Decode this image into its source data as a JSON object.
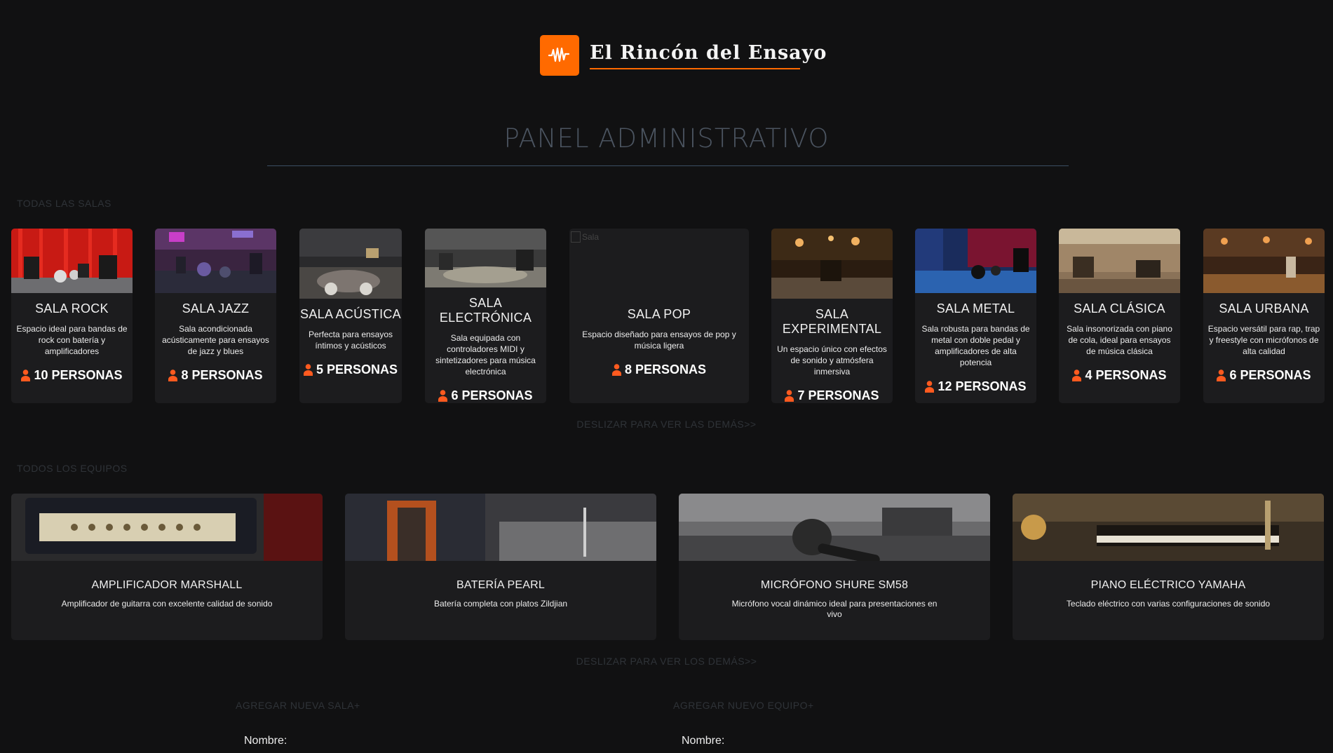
{
  "brand": {
    "name": "El Rincón del Ensayo",
    "accent": "#ff6a00",
    "logo_icon": "soundwave-icon"
  },
  "page": {
    "title": "PANEL ADMINISTRATIVO"
  },
  "rooms_section": {
    "label": "TODAS LAS SALAS",
    "swipe_hint": "DESLIZAR PARA VER LAS DEMÁS>>",
    "items": [
      {
        "name": "SALA ROCK",
        "description": "Espacio ideal para bandas de rock con batería y amplificadores",
        "capacity": "10 PERSONAS"
      },
      {
        "name": "SALA JAZZ",
        "description": "Sala acondicionada acústicamente para ensayos de jazz y blues",
        "capacity": "8 PERSONAS"
      },
      {
        "name": "SALA ACÚSTICA",
        "description": "Perfecta para ensayos íntimos y acústicos",
        "capacity": "5 PERSONAS"
      },
      {
        "name": "SALA ELECTRÓNICA",
        "description": "Sala equipada con controladores MIDI y sintetizadores para música electrónica",
        "capacity": "6 PERSONAS"
      },
      {
        "name": "SALA POP",
        "description": "Espacio diseñado para ensayos de pop y música ligera",
        "capacity": "8 PERSONAS",
        "image_alt": "Sala"
      },
      {
        "name": "SALA EXPERIMENTAL",
        "description": "Un espacio único con efectos de sonido y atmósfera inmersiva",
        "capacity": "7 PERSONAS"
      },
      {
        "name": "SALA METAL",
        "description": "Sala robusta para bandas de metal con doble pedal y amplificadores de alta potencia",
        "capacity": "12 PERSONAS"
      },
      {
        "name": "SALA CLÁSICA",
        "description": "Sala insonorizada con piano de cola, ideal para ensayos de música clásica",
        "capacity": "4 PERSONAS"
      },
      {
        "name": "SALA URBANA",
        "description": "Espacio versátil para rap, trap y freestyle con micrófonos de alta calidad",
        "capacity": "6 PERSONAS"
      }
    ]
  },
  "equipment_section": {
    "label": "TODOS LOS EQUIPOS",
    "swipe_hint": "DESLIZAR PARA VER LOS DEMÁS>>",
    "items": [
      {
        "name": "AMPLIFICADOR MARSHALL",
        "description": "Amplificador de guitarra con excelente calidad de sonido"
      },
      {
        "name": "BATERÍA PEARL",
        "description": "Batería completa con platos Zildjian"
      },
      {
        "name": "MICRÓFONO SHURE SM58",
        "description": "Micrófono vocal dinámico ideal para presentaciones en vivo"
      },
      {
        "name": "PIANO ELÉCTRICO YAMAHA",
        "description": "Teclado eléctrico con varias configuraciones de sonido"
      }
    ]
  },
  "forms": {
    "new_room": {
      "heading": "AGREGAR NUEVA SALA+",
      "name_label": "Nombre:"
    },
    "new_equipment": {
      "heading": "AGREGAR NUEVO EQUIPO+",
      "name_label": "Nombre:"
    }
  }
}
